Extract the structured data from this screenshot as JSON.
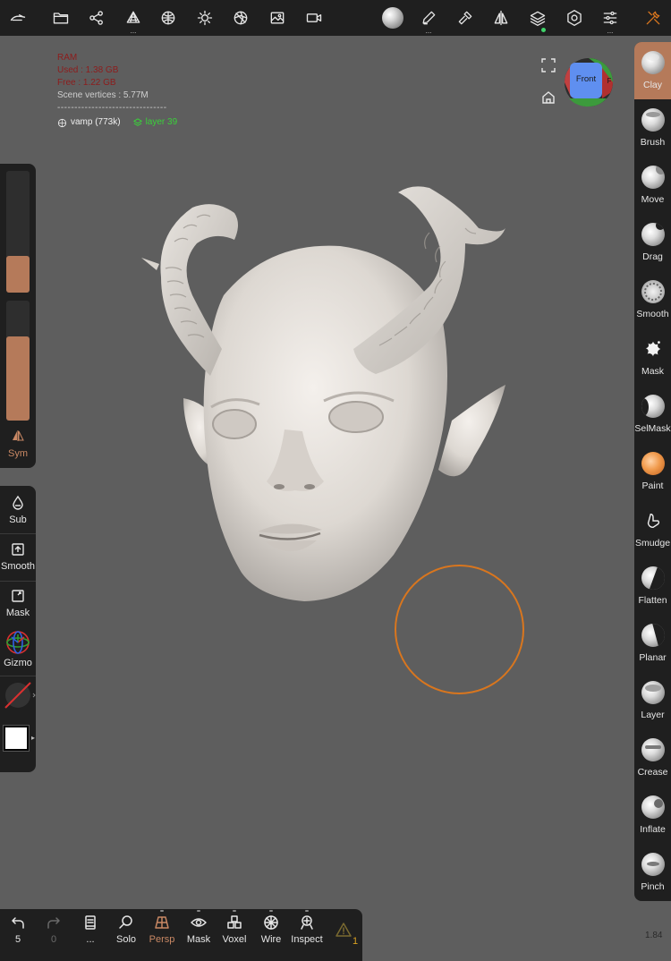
{
  "stats": {
    "ram_title": "RAM",
    "used": "Used : 1.38 GB",
    "free": "Free : 1.22 GB",
    "scene_vertices": "Scene vertices : 5.77M",
    "separator": "--------------------------------",
    "mesh_name": "vamp (773k)",
    "layer_name": "layer 39"
  },
  "view_cube": {
    "front_label": "Front"
  },
  "left_panel": {
    "radius_value": 0.3,
    "intensity_value": 0.7,
    "sym_label": "Sym",
    "tools": [
      "Sub",
      "Smooth",
      "Mask",
      "Gizmo"
    ]
  },
  "right_tools": [
    {
      "label": "Clay",
      "active": true
    },
    {
      "label": "Brush"
    },
    {
      "label": "Move"
    },
    {
      "label": "Drag"
    },
    {
      "label": "Smooth"
    },
    {
      "label": "Mask"
    },
    {
      "label": "SelMask"
    },
    {
      "label": "Paint"
    },
    {
      "label": "Smudge"
    },
    {
      "label": "Flatten"
    },
    {
      "label": "Planar"
    },
    {
      "label": "Layer"
    },
    {
      "label": "Crease"
    },
    {
      "label": "Inflate"
    },
    {
      "label": "Pinch"
    }
  ],
  "bottom_bar": {
    "undo_count": "5",
    "redo_count": "0",
    "more": "...",
    "solo": "Solo",
    "persp": "Persp",
    "mask": "Mask",
    "voxel": "Voxel",
    "wire": "Wire",
    "inspect": "Inspect",
    "warning_count": "1"
  },
  "top_bar": {
    "icons": [
      "app-logo-icon",
      "folder-icon",
      "scene-graph-icon",
      "topology-icon",
      "multires-icon",
      "light-icon",
      "shading-icon",
      "background-icon",
      "video-icon",
      "material-icon",
      "stroke-icon",
      "paint-brush-icon",
      "symmetry-icon",
      "layers-icon",
      "settings-icon",
      "sliders-icon",
      "tools-icon"
    ],
    "dots": "..."
  },
  "version": "1.84",
  "colors": {
    "accent": "#b57a5a",
    "brush_ring": "#d9761e",
    "ram_text": "#8d1c1c",
    "layer_text": "#3ad13a"
  }
}
